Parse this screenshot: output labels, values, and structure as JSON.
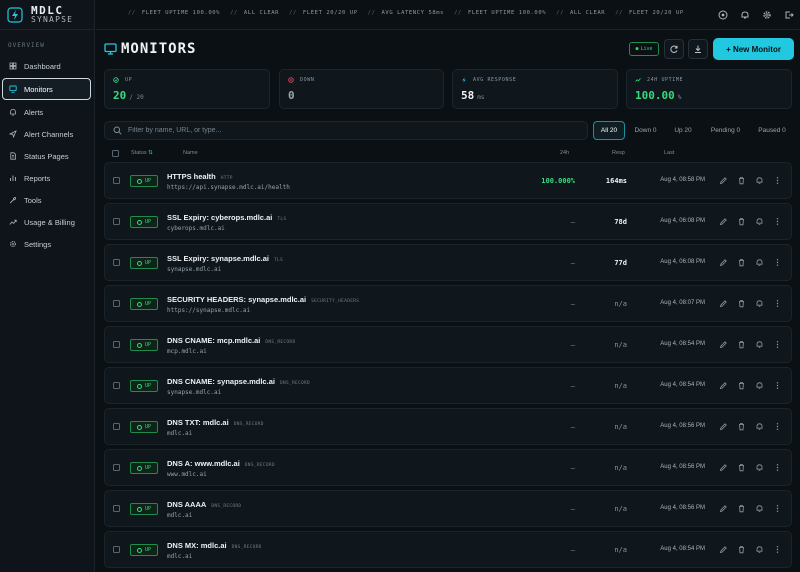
{
  "brand": {
    "name": "MDLC",
    "sub": "SYNAPSE"
  },
  "sidebar": {
    "section": "OVERVIEW",
    "items": [
      {
        "label": "Dashboard",
        "icon": "dashboard-icon"
      },
      {
        "label": "Monitors",
        "icon": "monitor-icon",
        "active": true
      },
      {
        "label": "Alerts",
        "icon": "bell-icon"
      },
      {
        "label": "Alert Channels",
        "icon": "send-icon"
      },
      {
        "label": "Status Pages",
        "icon": "document-icon"
      },
      {
        "label": "Reports",
        "icon": "chart-icon"
      },
      {
        "label": "Tools",
        "icon": "wrench-icon"
      },
      {
        "label": "Usage & Billing",
        "icon": "trend-icon"
      },
      {
        "label": "Settings",
        "icon": "gear-icon"
      }
    ]
  },
  "ticker": [
    "FLEET UPTIME 100.00%",
    "ALL CLEAR",
    "FLEET 20/20 UP",
    "AVG LATENCY 58ms",
    "FLEET UPTIME 100.00%",
    "ALL CLEAR",
    "FLEET 20/20 UP"
  ],
  "header": {
    "title": "MONITORS",
    "live": "Live",
    "new_monitor": "+ New Monitor"
  },
  "stats": [
    {
      "label": "UP",
      "value": "20",
      "suffix": "/ 20",
      "color": "#35db7e"
    },
    {
      "label": "DOWN",
      "value": "0",
      "suffix": "",
      "color": "#9aa5ad"
    },
    {
      "label": "AVG RESPONSE",
      "value": "58",
      "suffix": "ms",
      "color": "#eef2f5"
    },
    {
      "label": "24H UPTIME",
      "value": "100.00",
      "suffix": "%",
      "color": "#35db7e"
    }
  ],
  "filters": {
    "search_placeholder": "Filter by name, URL, or type...",
    "tabs": [
      "All 20",
      "Down 0",
      "Up 20",
      "Pending 0",
      "Paused 0"
    ]
  },
  "table": {
    "headers": {
      "status": "Status",
      "name": "Name",
      "h24": "24h",
      "resp": "Resp",
      "last": "Last"
    },
    "rows": [
      {
        "status": "UP",
        "name": "HTTPS health",
        "type": "HTTP",
        "url": "https://api.synapse.mdlc.ai/health",
        "h24": "100.000%",
        "resp": "164ms",
        "last": "Aug 4, 08:58 PM"
      },
      {
        "status": "UP",
        "name": "SSL Expiry: cyberops.mdlc.ai",
        "type": "TLS",
        "url": "cyberops.mdlc.ai",
        "h24": "–",
        "resp": "78d",
        "last": "Aug 4, 06:08 PM"
      },
      {
        "status": "UP",
        "name": "SSL Expiry: synapse.mdlc.ai",
        "type": "TLS",
        "url": "synapse.mdlc.ai",
        "h24": "–",
        "resp": "77d",
        "last": "Aug 4, 06:08 PM"
      },
      {
        "status": "UP",
        "name": "SECURITY HEADERS: synapse.mdlc.ai",
        "type": "SECURITY_HEADERS",
        "url": "https://synapse.mdlc.ai",
        "h24": "–",
        "resp": "n/a",
        "last": "Aug 4, 08:07 PM"
      },
      {
        "status": "UP",
        "name": "DNS CNAME: mcp.mdlc.ai",
        "type": "DNS_RECORD",
        "url": "mcp.mdlc.ai",
        "h24": "–",
        "resp": "n/a",
        "last": "Aug 4, 08:54 PM"
      },
      {
        "status": "UP",
        "name": "DNS CNAME: synapse.mdlc.ai",
        "type": "DNS_RECORD",
        "url": "synapse.mdlc.ai",
        "h24": "–",
        "resp": "n/a",
        "last": "Aug 4, 08:54 PM"
      },
      {
        "status": "UP",
        "name": "DNS TXT: mdlc.ai",
        "type": "DNS_RECORD",
        "url": "mdlc.ai",
        "h24": "–",
        "resp": "n/a",
        "last": "Aug 4, 08:56 PM"
      },
      {
        "status": "UP",
        "name": "DNS A: www.mdlc.ai",
        "type": "DNS_RECORD",
        "url": "www.mdlc.ai",
        "h24": "–",
        "resp": "n/a",
        "last": "Aug 4, 08:56 PM"
      },
      {
        "status": "UP",
        "name": "DNS AAAA",
        "type": "DNS_RECORD",
        "url": "mdlc.ai",
        "h24": "–",
        "resp": "n/a",
        "last": "Aug 4, 08:56 PM"
      },
      {
        "status": "UP",
        "name": "DNS MX: mdlc.ai",
        "type": "DNS_RECORD",
        "url": "mdlc.ai",
        "h24": "–",
        "resp": "n/a",
        "last": "Aug 4, 08:54 PM"
      }
    ]
  },
  "colors": {
    "accent": "#22c8e0",
    "up": "#35db7e",
    "down": "#e0465a"
  }
}
